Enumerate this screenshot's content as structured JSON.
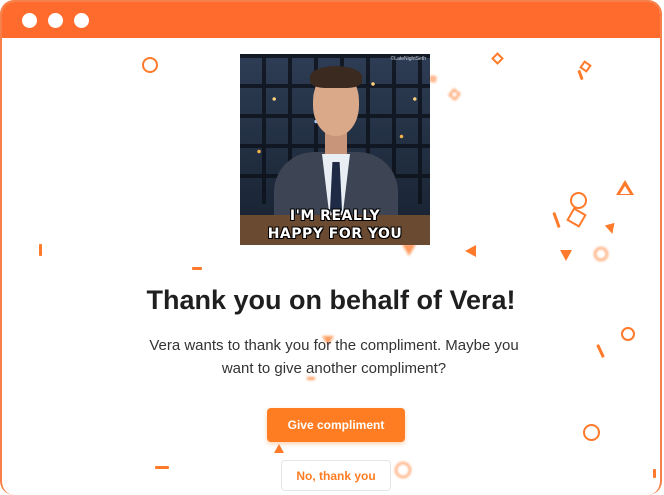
{
  "window": {
    "titlebar_color": "#ff6b2c",
    "controls": [
      "window-dot",
      "window-dot",
      "window-dot"
    ]
  },
  "gif": {
    "watermark": "©LateNightSeth",
    "caption_line1": "I'M REALLY",
    "caption_line2": "HAPPY FOR YOU"
  },
  "main": {
    "headline": "Thank you on behalf of Vera!",
    "subtext_line1": "Vera wants to thank you for the compliment. Maybe you",
    "subtext_line2": "want to give another compliment?"
  },
  "actions": {
    "primary_label": "Give compliment",
    "secondary_label": "No, thank you"
  },
  "colors": {
    "accent": "#ff7d22",
    "confetti": "#ff7a2a"
  }
}
